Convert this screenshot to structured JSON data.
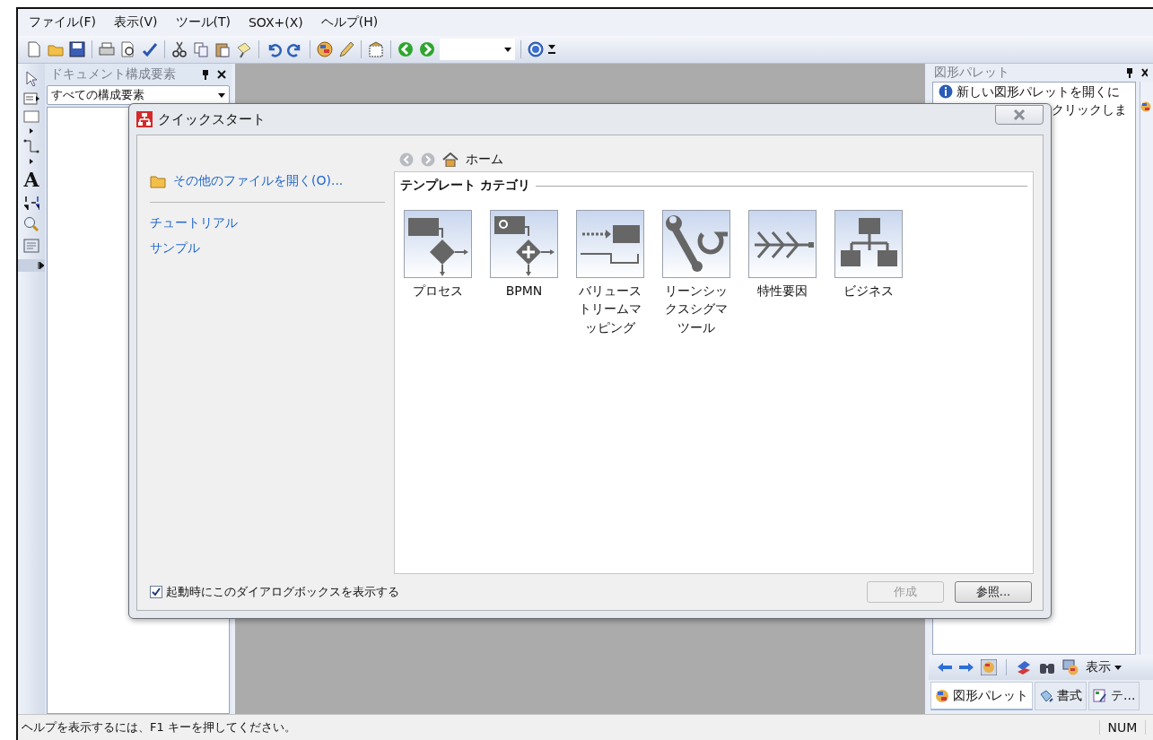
{
  "menu": [
    "ファイル(F)",
    "表示(V)",
    "ツール(T)",
    "SOX+(X)",
    "ヘルプ(H)"
  ],
  "left_panel": {
    "title": "ドキュメント構成要素",
    "filter": "すべての構成要素"
  },
  "tool_strip": {
    "text_tool": "A"
  },
  "right_panel": {
    "title": "図形パレット",
    "info_lines": [
      "新しい図形パレットを開くに",
      "クリックしま"
    ],
    "toolbar_label": "表示",
    "tabs": [
      {
        "label": "図形パレット",
        "selected": true
      },
      {
        "label": "書式",
        "selected": false
      },
      {
        "label": "テ...",
        "selected": false
      }
    ]
  },
  "dialog": {
    "title": "クイックスタート",
    "open_link": "その他のファイルを開く(O)...",
    "links": [
      "チュートリアル",
      "サンプル"
    ],
    "breadcrumb": "ホーム",
    "group_title": "テンプレート カテゴリ",
    "templates": [
      {
        "kind": "process",
        "label": "プロセス"
      },
      {
        "kind": "bpmn",
        "label": "BPMN"
      },
      {
        "kind": "value_stream",
        "label": "バリューストリームマッピング"
      },
      {
        "kind": "lean",
        "label": "リーンシックスシグマツール"
      },
      {
        "kind": "fishbone",
        "label": "特性要因"
      },
      {
        "kind": "org",
        "label": "ビジネス"
      }
    ],
    "show_on_startup": {
      "label": "起動時にこのダイアログボックスを表示する",
      "checked": true
    },
    "buttons": [
      {
        "label": "作成",
        "disabled": true
      },
      {
        "label": "参照...",
        "disabled": false
      }
    ]
  },
  "status_bar": {
    "message": "ヘルプを表示するには、F1 キーを押してください。",
    "indicator": "NUM"
  }
}
